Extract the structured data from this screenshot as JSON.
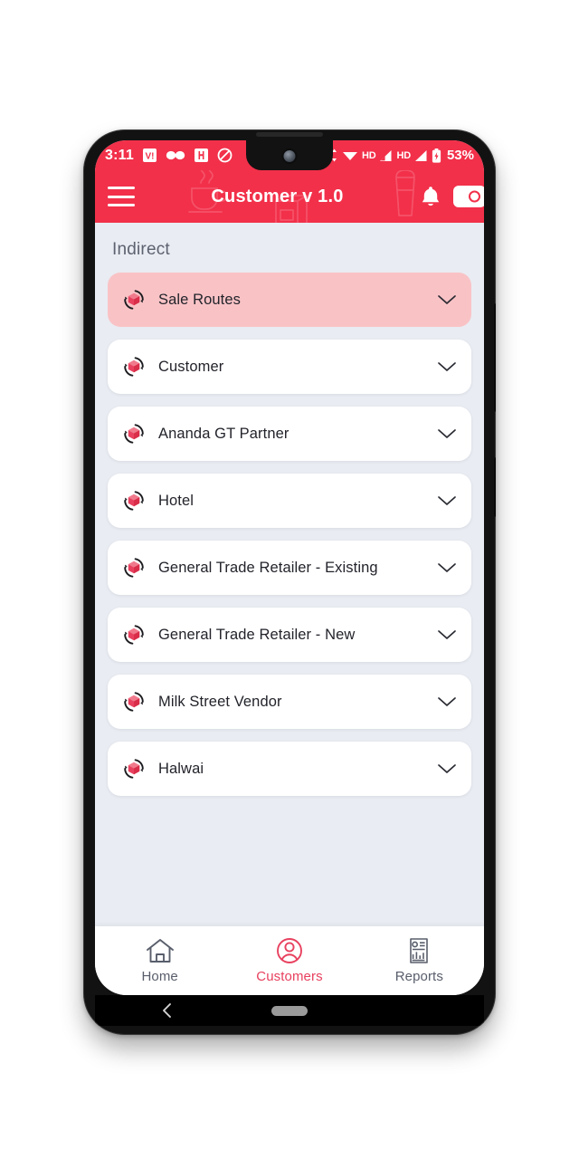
{
  "status_bar": {
    "clock": "3:11",
    "battery_percent": "53%",
    "hd_label_1": "HD",
    "hd_label_2": "HD",
    "icons": [
      "vi-carrier-icon",
      "glasses-icon",
      "app-notification-icon",
      "do-not-disturb-icon",
      "data-transfer-icon",
      "wifi-icon",
      "signal-1-icon",
      "signal-2-icon",
      "battery-icon"
    ]
  },
  "header": {
    "title": "Customer v 1.0",
    "menu_icon": "hamburger-menu-icon",
    "bell_icon": "bell-icon",
    "wallet_icon": "wallet-icon",
    "accent_color": "#F2304A",
    "watermarks": [
      "coffee-cup-icon",
      "milk-pack-icon",
      "milk-glass-icon"
    ]
  },
  "content": {
    "section_label": "Indirect",
    "items": [
      {
        "label": "Sale Routes",
        "active": true
      },
      {
        "label": "Customer",
        "active": false
      },
      {
        "label": "Ananda GT Partner",
        "active": false
      },
      {
        "label": "Hotel",
        "active": false
      },
      {
        "label": "General Trade Retailer - Existing",
        "active": false
      },
      {
        "label": "General Trade Retailer - New",
        "active": false
      },
      {
        "label": "Milk Street Vendor",
        "active": false
      },
      {
        "label": "Halwai",
        "active": false
      }
    ],
    "item_icon": "rotating-box-icon",
    "expand_icon": "chevron-down-icon",
    "active_color": "#F9C3C6",
    "background_color": "#E9ECF2"
  },
  "bottom_nav": {
    "items": [
      {
        "label": "Home",
        "icon": "home-icon",
        "active": false
      },
      {
        "label": "Customers",
        "icon": "user-circle-icon",
        "active": true
      },
      {
        "label": "Reports",
        "icon": "report-document-icon",
        "active": false
      }
    ],
    "active_color": "#E8415F"
  },
  "android_nav": {
    "back_icon": "back-chevron-icon",
    "home_pill": "home-pill-indicator"
  }
}
